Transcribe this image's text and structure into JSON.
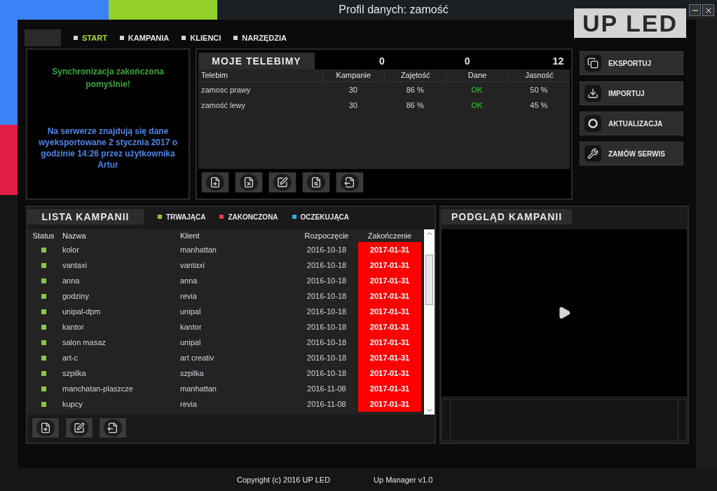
{
  "window": {
    "title": "Profil danych: zamość",
    "logo": "UP LED"
  },
  "nav": [
    {
      "label": "START",
      "selected": true
    },
    {
      "label": "KAMPANIA",
      "selected": false
    },
    {
      "label": "KLIENCI",
      "selected": false
    },
    {
      "label": "NARZĘDZIA",
      "selected": false
    }
  ],
  "sync_panel": {
    "status": "Synchronizacja zakończona pomyślnie!",
    "info": "Na serwerze znajdują się dane wyeksportowane 2 stycznia 2017 o godzinie 14:26 przez użytkownika Artur"
  },
  "telebimy": {
    "title": "MOJE TELEBIMY",
    "counters": [
      "0",
      "0",
      "12"
    ],
    "columns": [
      "Telebim",
      "Kampanie",
      "Zajętość",
      "Dane",
      "Jasność"
    ],
    "rows": [
      [
        "zamosc prawy",
        "30",
        "86 %",
        "OK",
        "50 %"
      ],
      [
        "zamość lewy",
        "30",
        "86 %",
        "OK",
        "45 %"
      ]
    ]
  },
  "actions": [
    "EKSPORTUJ",
    "IMPORTUJ",
    "AKTUALIZACJA",
    "ZAMÓW SERWIS"
  ],
  "campaigns": {
    "title": "LISTA KAMPANII",
    "legend": [
      {
        "label": "TRWAJĄCA",
        "color": "#8dc63f"
      },
      {
        "label": "ZAKONCZONA",
        "color": "#e8334a"
      },
      {
        "label": "OCZEKUJĄCA",
        "color": "#29abe2"
      }
    ],
    "columns": [
      "Status",
      "Nazwa",
      "Klient",
      "Rozpoczęcie",
      "Zakończenie"
    ],
    "rows": [
      {
        "color": "#8dc63f",
        "name": "kolor",
        "client": "manhattan",
        "start": "2016-10-18",
        "end": "2017-01-31",
        "expired": true
      },
      {
        "color": "#8dc63f",
        "name": "vantaxi",
        "client": "vantaxi",
        "start": "2016-10-18",
        "end": "2017-01-31",
        "expired": true
      },
      {
        "color": "#8dc63f",
        "name": "anna",
        "client": "anna",
        "start": "2016-10-18",
        "end": "2017-01-31",
        "expired": true
      },
      {
        "color": "#8dc63f",
        "name": "godziny",
        "client": "revia",
        "start": "2016-10-18",
        "end": "2017-01-31",
        "expired": true
      },
      {
        "color": "#8dc63f",
        "name": "unipal-dpm",
        "client": "unipal",
        "start": "2016-10-18",
        "end": "2017-01-31",
        "expired": true
      },
      {
        "color": "#8dc63f",
        "name": "kantor",
        "client": "kantor",
        "start": "2016-10-18",
        "end": "2017-01-31",
        "expired": true
      },
      {
        "color": "#8dc63f",
        "name": "salon masaz",
        "client": "unipal",
        "start": "2016-10-18",
        "end": "2017-01-31",
        "expired": true
      },
      {
        "color": "#8dc63f",
        "name": "art-c",
        "client": "art creativ",
        "start": "2016-10-18",
        "end": "2017-01-31",
        "expired": true
      },
      {
        "color": "#8dc63f",
        "name": "szpilka",
        "client": "szpilka",
        "start": "2016-10-18",
        "end": "2017-01-31",
        "expired": true
      },
      {
        "color": "#8dc63f",
        "name": "manchatan-plaszcze",
        "client": "manhattan",
        "start": "2016-11-08",
        "end": "2017-01-31",
        "expired": true
      },
      {
        "color": "#8dc63f",
        "name": "kupcy",
        "client": "revia",
        "start": "2016-11-08",
        "end": "2017-01-31",
        "expired": true
      }
    ]
  },
  "preview": {
    "title": "PODGLĄD KAMPANII"
  },
  "footer": {
    "copyright": "Copyright (c) 2016 UP LED",
    "version": "Up Manager v1.0"
  }
}
